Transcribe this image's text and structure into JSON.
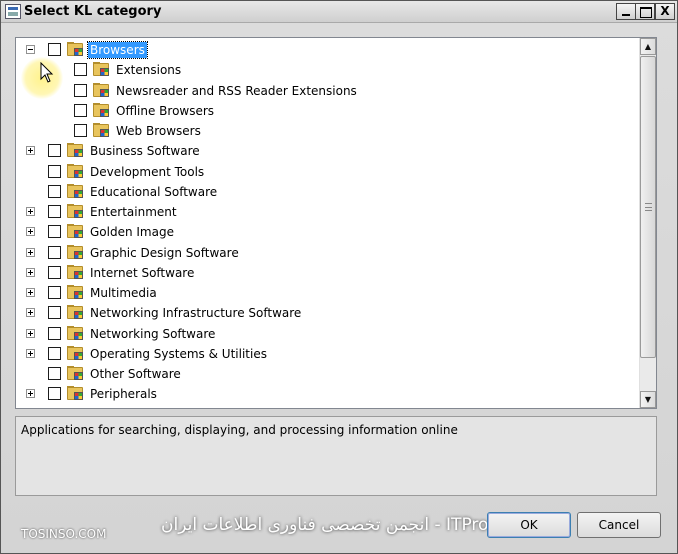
{
  "window": {
    "title": "Select KL category"
  },
  "titlebar_buttons": {
    "minimize_icon": "minimize-icon",
    "maximize_icon": "maximize-icon",
    "close_icon": "close-icon",
    "close_glyph": "X"
  },
  "tree": {
    "items": [
      {
        "label": "Browsers",
        "level": 0,
        "expander": "minus",
        "selected": true
      },
      {
        "label": "Extensions",
        "level": 1,
        "expander": "none",
        "selected": false
      },
      {
        "label": "Newsreader and RSS Reader Extensions",
        "level": 1,
        "expander": "none",
        "selected": false
      },
      {
        "label": "Offline Browsers",
        "level": 1,
        "expander": "none",
        "selected": false
      },
      {
        "label": "Web Browsers",
        "level": 1,
        "expander": "none",
        "selected": false
      },
      {
        "label": "Business Software",
        "level": 0,
        "expander": "plus",
        "selected": false
      },
      {
        "label": "Development Tools",
        "level": 0,
        "expander": "none",
        "selected": false
      },
      {
        "label": "Educational Software",
        "level": 0,
        "expander": "none",
        "selected": false
      },
      {
        "label": "Entertainment",
        "level": 0,
        "expander": "plus",
        "selected": false
      },
      {
        "label": "Golden Image",
        "level": 0,
        "expander": "plus",
        "selected": false
      },
      {
        "label": "Graphic Design Software",
        "level": 0,
        "expander": "plus",
        "selected": false
      },
      {
        "label": "Internet Software",
        "level": 0,
        "expander": "plus",
        "selected": false
      },
      {
        "label": "Multimedia",
        "level": 0,
        "expander": "plus",
        "selected": false
      },
      {
        "label": "Networking Infrastructure Software",
        "level": 0,
        "expander": "plus",
        "selected": false
      },
      {
        "label": "Networking Software",
        "level": 0,
        "expander": "plus",
        "selected": false
      },
      {
        "label": "Operating Systems & Utilities",
        "level": 0,
        "expander": "plus",
        "selected": false
      },
      {
        "label": "Other Software",
        "level": 0,
        "expander": "none",
        "selected": false
      },
      {
        "label": "Peripherals",
        "level": 0,
        "expander": "plus",
        "selected": false
      }
    ]
  },
  "description": {
    "text": "Applications for searching, displaying, and processing information online"
  },
  "buttons": {
    "ok": "OK",
    "cancel": "Cancel"
  },
  "watermarks": {
    "left": "TOSINSO.COM",
    "center": "ITPro.ir - انجمن تخصصی فناوری اطلاعات ایران"
  },
  "colors": {
    "selection": "#3399ff",
    "folder": "#e8c45c"
  }
}
